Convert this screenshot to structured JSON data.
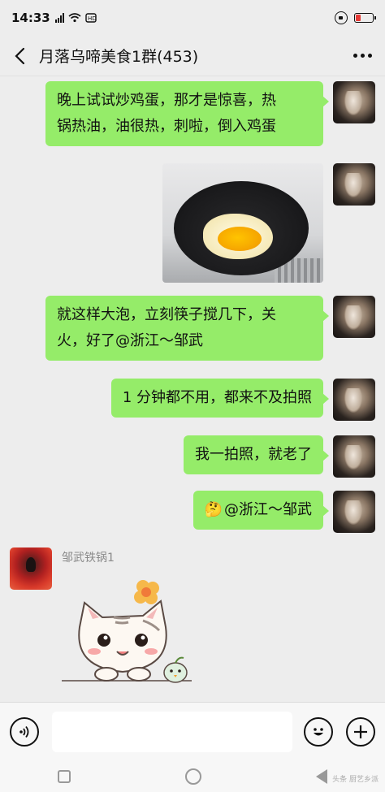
{
  "status_bar": {
    "time": "14:33",
    "signal_label": "4G",
    "wifi_icon": "wifi-icon",
    "lock_icon": "rotation-lock-icon",
    "battery_color": "#e53935",
    "battery_level": 0.25
  },
  "nav": {
    "title": "月落乌啼美食1群(453)",
    "back_icon": "chevron-left-icon",
    "more_icon": "more-dots-icon"
  },
  "messages": [
    {
      "side": "right",
      "type": "text",
      "text_line1": "晚上试试炒鸡蛋，那才是惊喜，热",
      "text_line2": "锅热油，油很热，刺啦，倒入鸡蛋"
    },
    {
      "side": "right",
      "type": "image",
      "image_desc": "photo"
    },
    {
      "side": "right",
      "type": "text",
      "text_line1": "就这样大泡，立刻筷子搅几下，关",
      "text_line2": "火，好了@浙江～邹武"
    },
    {
      "side": "right",
      "type": "text",
      "text_line1": "1 分钟都不用，都来不及拍照"
    },
    {
      "side": "right",
      "type": "text",
      "text_line1": "我一拍照，就老了"
    },
    {
      "side": "right",
      "type": "text",
      "emoji": "🤔",
      "text_line1": "@浙江～邹武"
    },
    {
      "side": "left",
      "type": "sticker",
      "sender": "邹武铁锅1"
    }
  ],
  "input_bar": {
    "voice_icon": "voice-icon",
    "emoji_icon": "emoji-icon",
    "plus_icon": "plus-icon"
  },
  "sys_nav": {
    "footnote": "头条 厨艺乡派"
  },
  "colors": {
    "bubble_green": "#95ec69",
    "background": "#ededed"
  }
}
